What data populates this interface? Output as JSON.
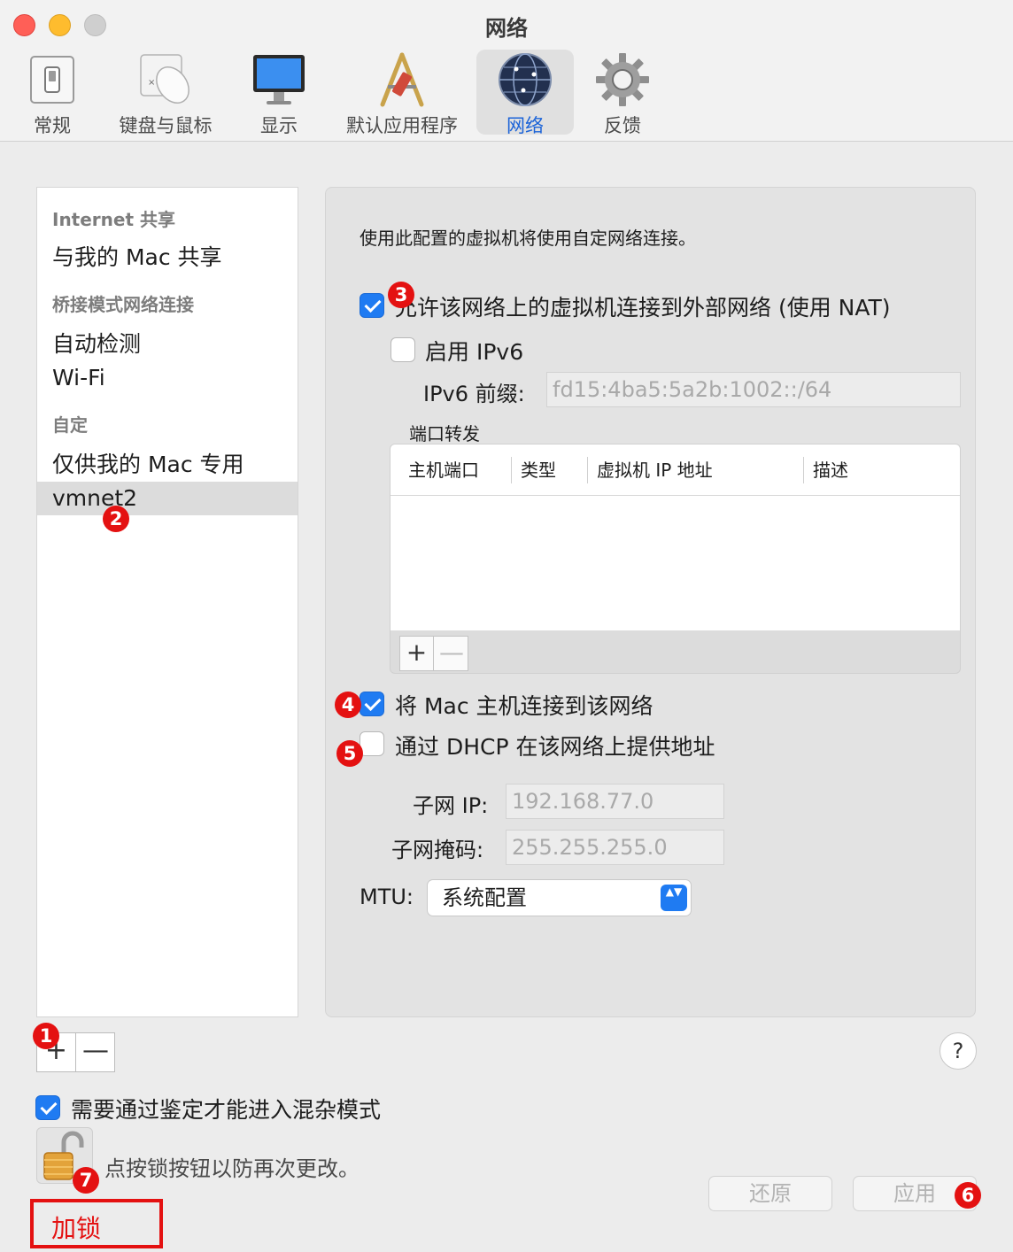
{
  "window": {
    "title": "网络"
  },
  "toolbar": {
    "items": [
      {
        "label": "常规",
        "icon": "general-switch-icon"
      },
      {
        "label": "键盘与鼠标",
        "icon": "keyboard-mouse-icon"
      },
      {
        "label": "显示",
        "icon": "display-monitor-icon"
      },
      {
        "label": "默认应用程序",
        "icon": "default-apps-icon"
      },
      {
        "label": "网络",
        "icon": "network-globe-icon",
        "active": true
      },
      {
        "label": "反馈",
        "icon": "gear-icon"
      }
    ]
  },
  "sidebar": {
    "sections": [
      {
        "header": "Internet 共享",
        "items": [
          "与我的 Mac 共享"
        ]
      },
      {
        "header": "桥接模式网络连接",
        "items": [
          "自动检测",
          "Wi-Fi"
        ]
      },
      {
        "header": "自定",
        "items": [
          "仅供我的 Mac 专用",
          "vmnet2"
        ]
      }
    ],
    "selected": "vmnet2",
    "add_label": "+",
    "remove_label": "—"
  },
  "config": {
    "intro": "使用此配置的虚拟机将使用自定网络连接。",
    "nat": {
      "label": "允许该网络上的虚拟机连接到外部网络 (使用 NAT)",
      "checked": true
    },
    "ipv6": {
      "label": "启用 IPv6",
      "checked": false
    },
    "ipv6_prefix": {
      "label": "IPv6 前缀:",
      "value": "fd15:4ba5:5a2b:1002::/64"
    },
    "port_forwarding": {
      "label": "端口转发",
      "columns": [
        "主机端口",
        "类型",
        "虚拟机 IP 地址",
        "描述"
      ],
      "rows": [],
      "add_label": "+",
      "remove_label": "—"
    },
    "host_connect": {
      "label": "将 Mac 主机连接到该网络",
      "checked": true
    },
    "dhcp": {
      "label": "通过 DHCP 在该网络上提供地址",
      "checked": false
    },
    "subnet_ip": {
      "label": "子网 IP:",
      "value": "192.168.77.0"
    },
    "subnet_mask": {
      "label": "子网掩码:",
      "value": "255.255.255.0"
    },
    "mtu": {
      "label": "MTU:",
      "value": "系统配置",
      "stepper": "▲▼"
    }
  },
  "footer": {
    "help_label": "?",
    "promiscuous": {
      "label": "需要通过鉴定才能进入混杂模式",
      "checked": true
    },
    "lock_text": "点按锁按钮以防再次更改。",
    "revert_label": "还原",
    "apply_label": "应用"
  },
  "annotations": {
    "badges": [
      "1",
      "2",
      "3",
      "4",
      "5",
      "6",
      "7"
    ],
    "box_text": "加锁",
    "color": "#e41111"
  },
  "colors": {
    "accent": "#1f7bf2",
    "badge": "#e41111",
    "selected_row": "#dcdcdc"
  }
}
